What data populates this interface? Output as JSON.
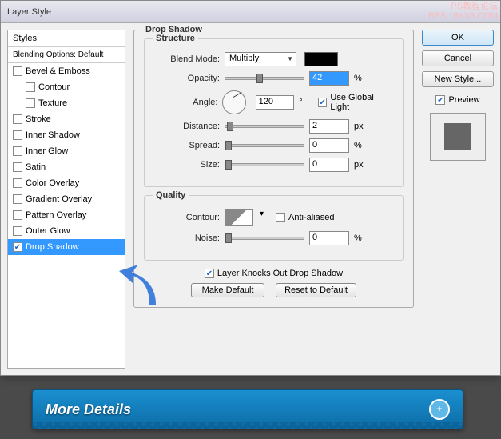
{
  "watermark": {
    "line1": "PS教程论坛",
    "line2": "BBS.16XX8.COM"
  },
  "window": {
    "title": "Layer Style"
  },
  "styles": {
    "header": "Styles",
    "blendingDefault": "Blending Options: Default",
    "items": [
      {
        "label": "Bevel & Emboss",
        "checked": false,
        "indent": false
      },
      {
        "label": "Contour",
        "checked": false,
        "indent": true
      },
      {
        "label": "Texture",
        "checked": false,
        "indent": true
      },
      {
        "label": "Stroke",
        "checked": false,
        "indent": false
      },
      {
        "label": "Inner Shadow",
        "checked": false,
        "indent": false
      },
      {
        "label": "Inner Glow",
        "checked": false,
        "indent": false
      },
      {
        "label": "Satin",
        "checked": false,
        "indent": false
      },
      {
        "label": "Color Overlay",
        "checked": false,
        "indent": false
      },
      {
        "label": "Gradient Overlay",
        "checked": false,
        "indent": false
      },
      {
        "label": "Pattern Overlay",
        "checked": false,
        "indent": false
      },
      {
        "label": "Outer Glow",
        "checked": false,
        "indent": false
      },
      {
        "label": "Drop Shadow",
        "checked": true,
        "indent": false,
        "selected": true
      }
    ]
  },
  "effect": {
    "title": "Drop Shadow",
    "structure": {
      "legend": "Structure",
      "blendModeLabel": "Blend Mode:",
      "blendMode": "Multiply",
      "color": "#000000",
      "opacityLabel": "Opacity:",
      "opacity": "42",
      "opacityUnit": "%",
      "angleLabel": "Angle:",
      "angle": "120",
      "angleUnit": "°",
      "useGlobalLight": "Use Global Light",
      "useGlobalLightChecked": true,
      "distanceLabel": "Distance:",
      "distance": "2",
      "distanceUnit": "px",
      "spreadLabel": "Spread:",
      "spread": "0",
      "spreadUnit": "%",
      "sizeLabel": "Size:",
      "size": "0",
      "sizeUnit": "px"
    },
    "quality": {
      "legend": "Quality",
      "contourLabel": "Contour:",
      "antiAliased": "Anti-aliased",
      "antiAliasedChecked": false,
      "noiseLabel": "Noise:",
      "noise": "0",
      "noiseUnit": "%"
    },
    "knocksOut": "Layer Knocks Out Drop Shadow",
    "knocksOutChecked": true,
    "makeDefault": "Make Default",
    "resetDefault": "Reset to Default"
  },
  "buttons": {
    "ok": "OK",
    "cancel": "Cancel",
    "newStyle": "New Style...",
    "preview": "Preview",
    "previewChecked": true
  },
  "banner": {
    "text": "More Details",
    "icon": "+"
  }
}
